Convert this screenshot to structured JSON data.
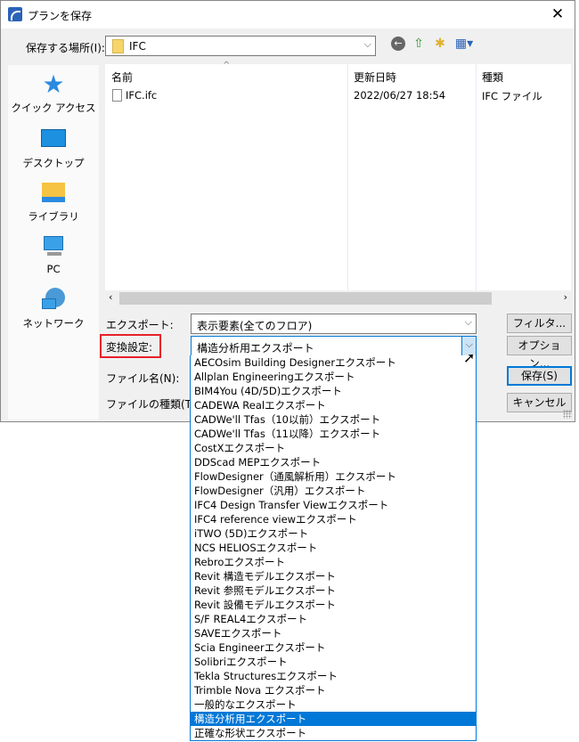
{
  "window": {
    "title": "プランを保存",
    "close": "✕"
  },
  "location": {
    "label": "保存する場所(I):",
    "value": "IFC"
  },
  "sidebar": {
    "items": [
      {
        "label": "クイック アクセス"
      },
      {
        "label": "デスクトップ"
      },
      {
        "label": "ライブラリ"
      },
      {
        "label": "PC"
      },
      {
        "label": "ネットワーク"
      }
    ]
  },
  "files": {
    "columns": [
      "名前",
      "更新日時",
      "種類"
    ],
    "rows": [
      {
        "name": "IFC.ifc",
        "date": "2022/06/27 18:54",
        "type": "IFC ファイル"
      }
    ]
  },
  "form": {
    "export_label": "エクスポート:",
    "export_value": "表示要素(全てのフロア)",
    "translator_label": "変換設定:",
    "translator_value": "構造分析用エクスポート",
    "filename_label": "ファイル名(N):",
    "filetype_label": "ファイルの種類(T):"
  },
  "buttons": {
    "filter": "フィルタ...",
    "options": "オプション...",
    "save": "保存(S)",
    "cancel": "キャンセル"
  },
  "dropdown": {
    "selected_index": 25,
    "options": [
      "AECOsim Building Designerエクスポート",
      "Allplan Engineeringエクスポート",
      "BIM4You (4D/5D)エクスポート",
      "CADEWA Realエクスポート",
      "CADWe'll Tfas（10以前）エクスポート",
      "CADWe'll Tfas（11以降）エクスポート",
      "CostXエクスポート",
      "DDScad MEPエクスポート",
      "FlowDesigner（通風解析用）エクスポート",
      "FlowDesigner（汎用）エクスポート",
      "IFC4 Design Transfer Viewエクスポート",
      "IFC4 reference viewエクスポート",
      "iTWO (5D)エクスポート",
      "NCS HELIOSエクスポート",
      "Rebroエクスポート",
      "Revit 構造モデルエクスポート",
      "Revit 参照モデルエクスポート",
      "Revit 設備モデルエクスポート",
      "S/F REAL4エクスポート",
      "SAVEエクスポート",
      "Scia Engineerエクスポート",
      "Solibriエクスポート",
      "Tekla Structuresエクスポート",
      "Trimble Nova エクスポート",
      "一般的なエクスポート",
      "構造分析用エクスポート",
      "正確な形状エクスポート"
    ]
  }
}
